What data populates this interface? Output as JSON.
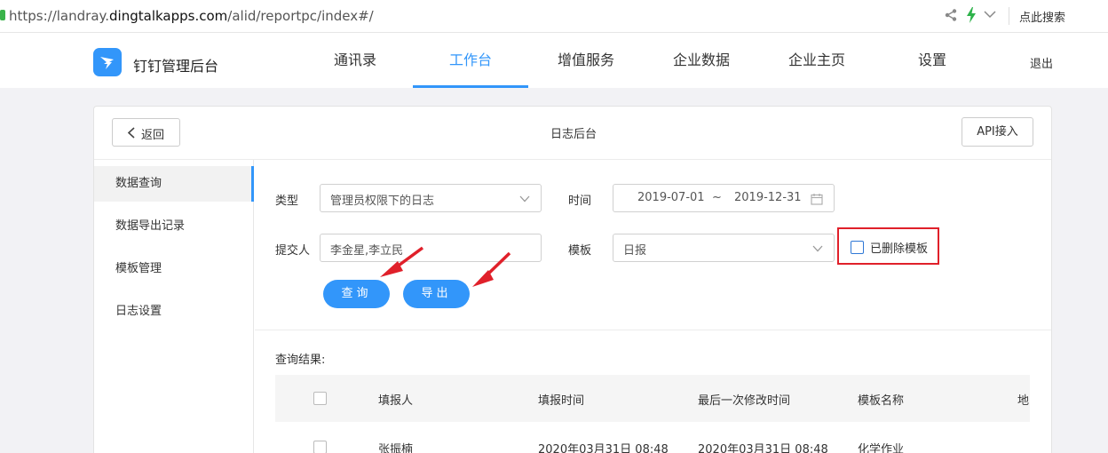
{
  "browser": {
    "url_prefix": "https://landray.",
    "url_host": "dingtalkapps.com",
    "url_path": "/alid/reportpc/index#/",
    "right_label": "点此搜索"
  },
  "header": {
    "app_title": "钉钉管理后台",
    "nav": [
      {
        "label": "通讯录"
      },
      {
        "label": "工作台"
      },
      {
        "label": "增值服务"
      },
      {
        "label": "企业数据"
      },
      {
        "label": "企业主页"
      },
      {
        "label": "设置"
      }
    ],
    "active_nav": "工作台",
    "logout": "退出",
    "accent_color": "#3296fa"
  },
  "card": {
    "back_label": "返回",
    "title": "日志后台",
    "api_label": "API接入"
  },
  "side_menu": [
    {
      "label": "数据查询"
    },
    {
      "label": "数据导出记录"
    },
    {
      "label": "模板管理"
    },
    {
      "label": "日志设置"
    }
  ],
  "active_side": "数据查询",
  "form": {
    "type_label": "类型",
    "type_value": "管理员权限下的日志",
    "time_label": "时间",
    "date_from": "2019-07-01",
    "date_sep": "~",
    "date_to": "2019-12-31",
    "submitter_label": "提交人",
    "submitter_value": "李金星,李立民",
    "template_label": "模板",
    "template_value": "日报",
    "deleted_templates_label": "已删除模板",
    "deleted_templates_checked": false,
    "query_button": "查询",
    "export_button": "导出"
  },
  "results": {
    "label": "查询结果:",
    "columns": [
      "填报人",
      "填报时间",
      "最后一次修改时间",
      "模板名称",
      "地"
    ],
    "rows": [
      {
        "name": "张振楠",
        "submit_time": "2020年03月31日 08:48",
        "modified_time": "2020年03月31日 08:48",
        "template": "化学作业"
      }
    ]
  },
  "highlight_color": "#e0202a"
}
